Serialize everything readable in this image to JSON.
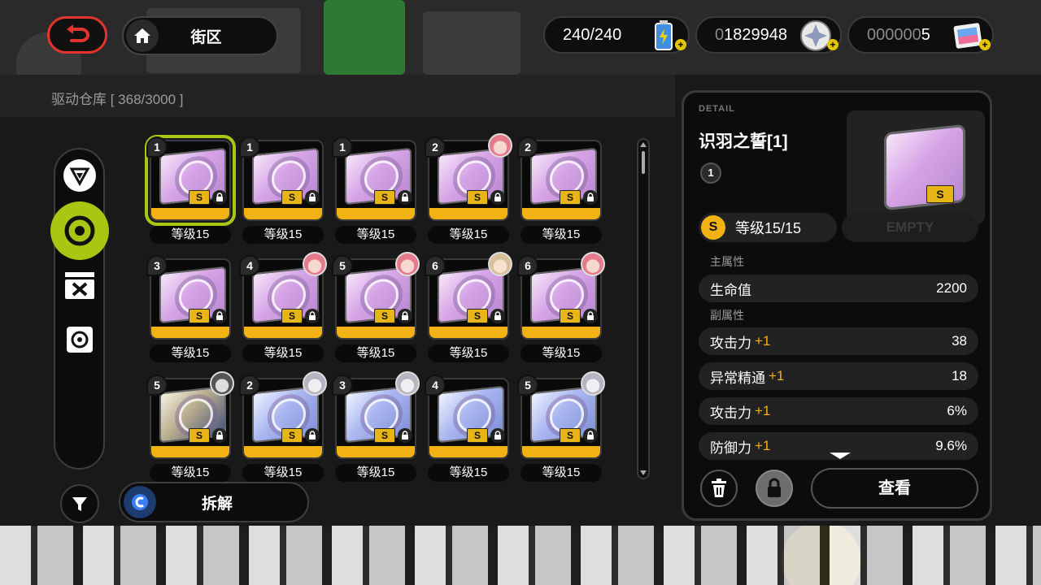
{
  "header": {
    "location": "街区",
    "currencies": [
      {
        "prefix": "",
        "value": "240/240",
        "icon": "battery-icon"
      },
      {
        "prefix": "0",
        "value": "1829948",
        "icon": "dennies-coin-icon"
      },
      {
        "prefix": "000000",
        "value": "5",
        "icon": "film-ticket-icon"
      }
    ]
  },
  "storage": {
    "label": "驱动仓库 [ 368/3000 ]"
  },
  "actions": {
    "dismantle": "拆解"
  },
  "grid": {
    "level_label": "等级15",
    "items": [
      {
        "slot": "1",
        "theme": "pink",
        "avatar": "",
        "selected": true
      },
      {
        "slot": "1",
        "theme": "pink",
        "avatar": ""
      },
      {
        "slot": "1",
        "theme": "pink",
        "avatar": ""
      },
      {
        "slot": "2",
        "theme": "pink",
        "avatar": "pink"
      },
      {
        "slot": "2",
        "theme": "pink",
        "avatar": ""
      },
      {
        "slot": "3",
        "theme": "pink",
        "avatar": ""
      },
      {
        "slot": "4",
        "theme": "pink",
        "avatar": "pink"
      },
      {
        "slot": "5",
        "theme": "pink",
        "avatar": "pink"
      },
      {
        "slot": "6",
        "theme": "pink",
        "avatar": "blonde"
      },
      {
        "slot": "6",
        "theme": "pink",
        "avatar": "pink"
      },
      {
        "slot": "5",
        "theme": "gold",
        "avatar": "dark"
      },
      {
        "slot": "2",
        "theme": "blue",
        "avatar": "silver"
      },
      {
        "slot": "3",
        "theme": "blue",
        "avatar": "silver"
      },
      {
        "slot": "4",
        "theme": "blue",
        "avatar": ""
      },
      {
        "slot": "5",
        "theme": "blue",
        "avatar": "silver"
      }
    ],
    "rarity_mark": "S"
  },
  "detail": {
    "tag": "DETAIL",
    "name": "识羽之誓[1]",
    "slot": "1",
    "rarity": "S",
    "level": "等级15/15",
    "empty": "EMPTY",
    "main_label": "主属性",
    "main_stat": {
      "name": "生命值",
      "value": "2200"
    },
    "sub_label": "副属性",
    "sub_stats": [
      {
        "name": "攻击力",
        "plus": "+1",
        "value": "38"
      },
      {
        "name": "异常精通",
        "plus": "+1",
        "value": "18"
      },
      {
        "name": "攻击力",
        "plus": "+1",
        "value": "6%"
      },
      {
        "name": "防御力",
        "plus": "+1",
        "value": "9.6%"
      }
    ],
    "view": "查看"
  },
  "colors": {
    "accent": "#a9c613",
    "gold": "#f2b213",
    "back": "#e2342c"
  }
}
